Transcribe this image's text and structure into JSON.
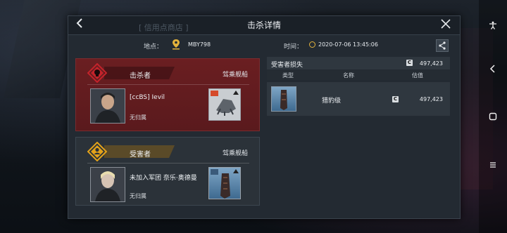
{
  "window": {
    "title": "击杀详情",
    "background_label": "[ 信用点商店 ]"
  },
  "info": {
    "location_label": "地点：",
    "location_value": "MBY798",
    "time_label": "时间：",
    "time_value": "2020-07-06 13:45:06"
  },
  "killer": {
    "role": "击杀者",
    "ship_header": "驾乘舰船",
    "name": "[ccBS]  Ievil",
    "corp": "无归属"
  },
  "victim": {
    "role": "受害者",
    "ship_header": "驾乘舰船",
    "name": "未加入军团  奈乐·奥德曼",
    "corp": "无归属"
  },
  "loss": {
    "title": "受害者损失",
    "currency_icon": "C",
    "total": "497,423",
    "columns": [
      "类型",
      "名称",
      "估值"
    ],
    "items": [
      {
        "name": "猎豹级",
        "value": "497,423"
      }
    ]
  },
  "colors": {
    "killer_accent": "#c4232b",
    "victim_accent": "#e3a21a",
    "panel_bg": "#232a32"
  },
  "icons": {
    "back": "chevron-left-icon",
    "close": "close-icon",
    "share": "share-icon",
    "location": "map-pin-icon",
    "time": "clock-icon",
    "killer_badge": "skull-badge-icon",
    "victim_badge": "person-badge-icon"
  }
}
